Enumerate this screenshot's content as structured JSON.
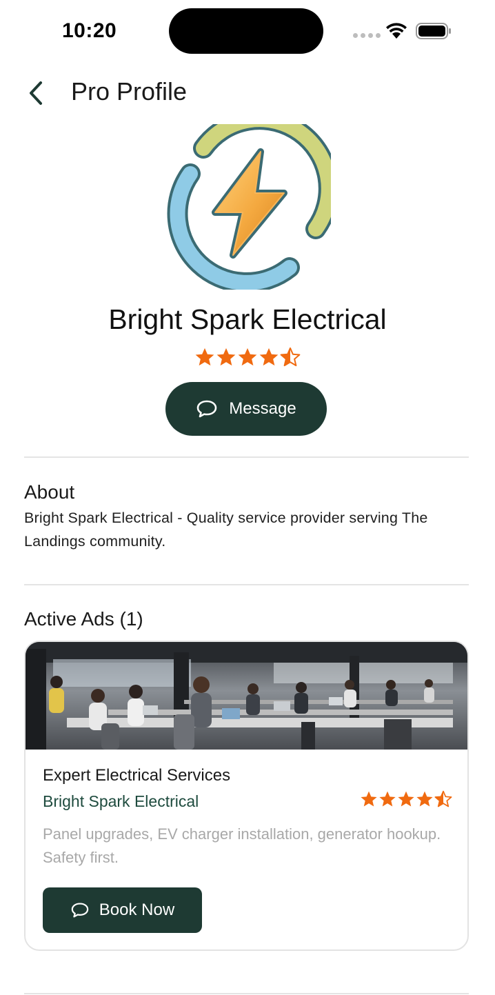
{
  "status_bar": {
    "time": "10:20"
  },
  "header": {
    "title": "Pro Profile"
  },
  "profile": {
    "name": "Bright Spark Electrical",
    "rating": 4.5,
    "message_label": "Message"
  },
  "about": {
    "title": "About",
    "text": "Bright Spark Electrical - Quality service provider serving The Landings community."
  },
  "active_ads": {
    "title": "Active Ads (1)",
    "items": [
      {
        "title": "Expert Electrical Services",
        "provider": "Bright Spark Electrical",
        "rating": 4.5,
        "description": "Panel upgrades, EV charger installation, generator hookup. Safety first.",
        "button_label": "Book Now"
      }
    ]
  },
  "colors": {
    "primary": "#1e3a33",
    "star": "#f06a10",
    "provider_text": "#1e4b3e"
  },
  "icons": [
    "back-chevron-icon",
    "chat-bubble-icon",
    "star-icon",
    "wifi-icon",
    "battery-icon"
  ]
}
